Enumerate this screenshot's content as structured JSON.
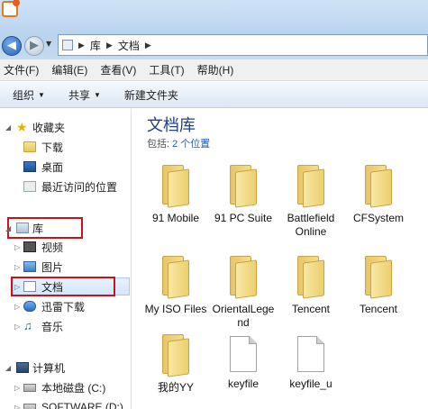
{
  "address": {
    "segments": [
      "库",
      "文档"
    ]
  },
  "menu": [
    "文件(F)",
    "编辑(E)",
    "查看(V)",
    "工具(T)",
    "帮助(H)"
  ],
  "toolbar": {
    "organize": "组织",
    "share": "共享",
    "new_folder": "新建文件夹"
  },
  "nav": {
    "favorites": "收藏夹",
    "downloads": "下载",
    "desktop": "桌面",
    "recent": "最近访问的位置",
    "library": "库",
    "videos": "视频",
    "pictures": "图片",
    "documents": "文档",
    "xunlei": "迅雷下载",
    "music": "音乐",
    "computer": "计算机",
    "local_disk": "本地磁盘 (C:)",
    "software": "SOFTWARE (D:)"
  },
  "content": {
    "title": "文档库",
    "includes_label": "包括:",
    "includes_link": "2 个位置",
    "items": [
      {
        "name": "91 Mobile",
        "type": "folder"
      },
      {
        "name": "91 PC Suite",
        "type": "folder"
      },
      {
        "name": "Battlefield Online",
        "type": "folder"
      },
      {
        "name": "CFSystem",
        "type": "folder"
      },
      {
        "name": "My ISO Files",
        "type": "folder"
      },
      {
        "name": "OrientalLegend",
        "type": "folder"
      },
      {
        "name": "Tencent",
        "type": "folder"
      },
      {
        "name": "Tencent",
        "type": "folder"
      },
      {
        "name": "我的YY",
        "type": "folder"
      },
      {
        "name": "keyfile",
        "type": "file"
      },
      {
        "name": "keyfile_u",
        "type": "file"
      }
    ]
  },
  "colors": {
    "accent_title": "#1e3f87",
    "link": "#1660c0",
    "highlight_box": "#c0171d"
  }
}
